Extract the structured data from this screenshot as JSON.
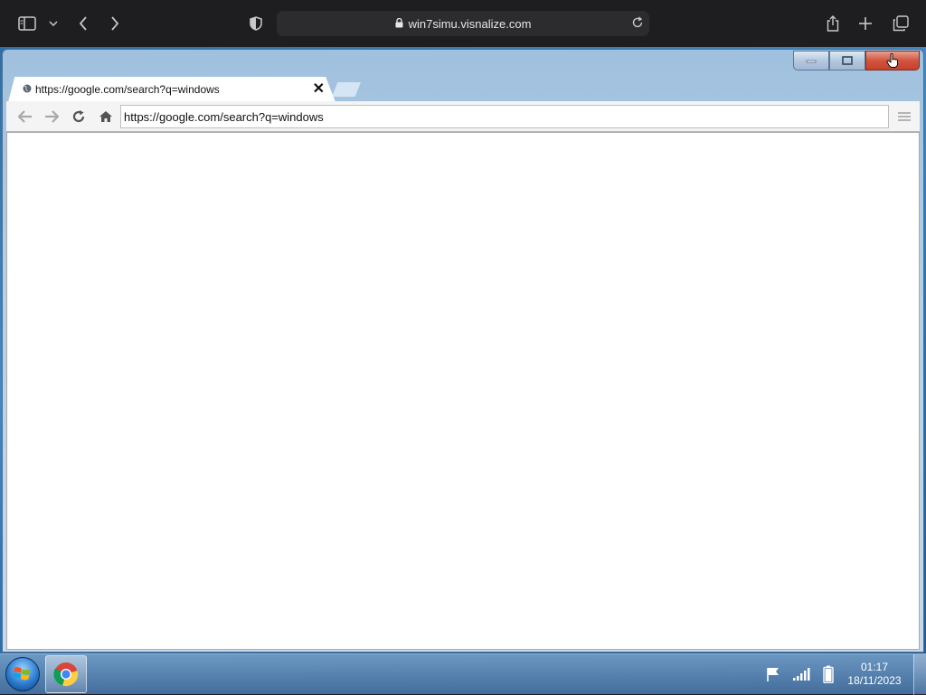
{
  "safari": {
    "url": "win7simu.visnalize.com",
    "icons": [
      "sidebar-icon",
      "chevron-down-icon",
      "back-icon",
      "forward-icon",
      "privacy-shield-icon",
      "lock-icon",
      "reload-icon",
      "share-icon",
      "plus-icon",
      "tabs-overview-icon"
    ]
  },
  "chrome_window": {
    "tab_title": "https://google.com/search?q=windows",
    "omnibox_value": "https://google.com/search?q=windows",
    "caption_buttons": [
      "minimize",
      "maximize",
      "close"
    ]
  },
  "taskbar": {
    "time": "01:17",
    "date": "18/11/2023",
    "pinned": [
      "chrome"
    ],
    "tray_icons": [
      "action-center-flag-icon",
      "network-signal-icon",
      "battery-icon"
    ]
  },
  "colors": {
    "close_button": "#d2553f",
    "desktop_blue": "#2f6fa8",
    "safari_bar": "#1e1e20"
  }
}
